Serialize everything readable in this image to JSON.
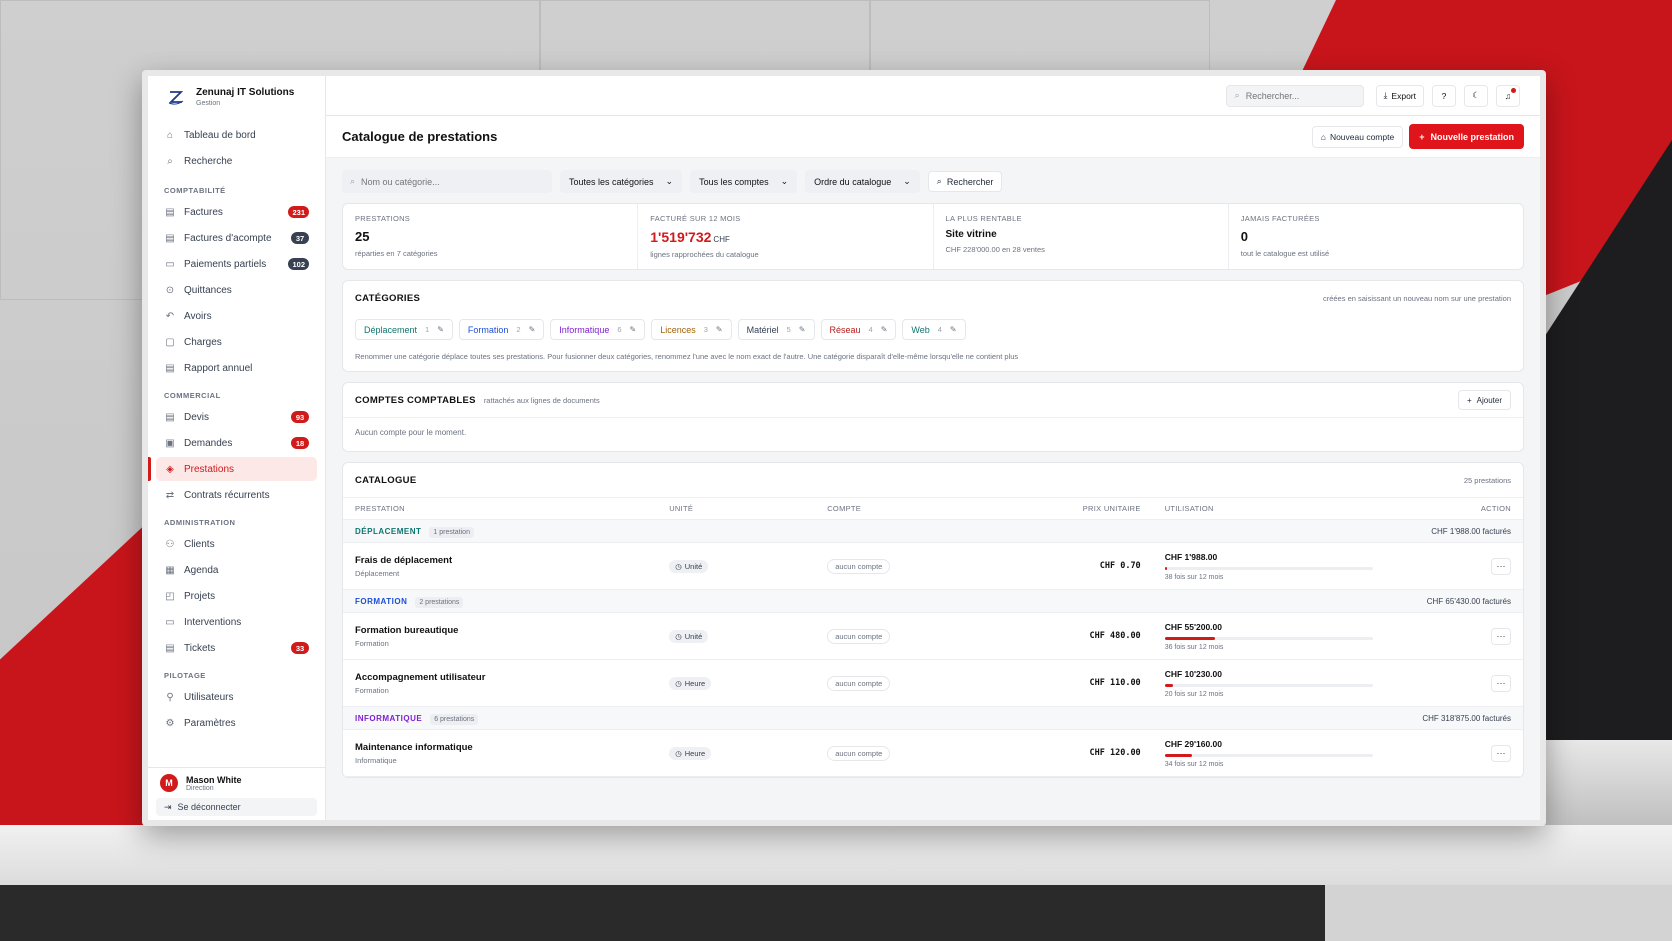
{
  "brand": {
    "name": "Zenunaj IT Solutions",
    "sub": "Gestion"
  },
  "nav": {
    "top": [
      {
        "label": "Tableau de bord",
        "icon": "home-icon"
      },
      {
        "label": "Recherche",
        "icon": "search-icon"
      }
    ],
    "sections": [
      {
        "title": "COMPTABILITÉ",
        "items": [
          {
            "label": "Factures",
            "badge": "231",
            "badge_color": "red"
          },
          {
            "label": "Factures d'acompte",
            "badge": "37",
            "badge_color": "gray"
          },
          {
            "label": "Paiements partiels",
            "badge": "102",
            "badge_color": "gray"
          },
          {
            "label": "Quittances",
            "badge": ""
          },
          {
            "label": "Avoirs",
            "badge": ""
          },
          {
            "label": "Charges",
            "badge": ""
          },
          {
            "label": "Rapport annuel",
            "badge": ""
          }
        ]
      },
      {
        "title": "COMMERCIAL",
        "items": [
          {
            "label": "Devis",
            "badge": "93",
            "badge_color": "red"
          },
          {
            "label": "Demandes",
            "badge": "18",
            "badge_color": "red"
          },
          {
            "label": "Prestations",
            "badge": "",
            "active": true
          },
          {
            "label": "Contrats récurrents",
            "badge": ""
          }
        ]
      },
      {
        "title": "ADMINISTRATION",
        "items": [
          {
            "label": "Clients",
            "badge": ""
          },
          {
            "label": "Agenda",
            "badge": ""
          },
          {
            "label": "Projets",
            "badge": ""
          },
          {
            "label": "Interventions",
            "badge": ""
          },
          {
            "label": "Tickets",
            "badge": "33",
            "badge_color": "red"
          }
        ]
      },
      {
        "title": "PILOTAGE",
        "items": [
          {
            "label": "Utilisateurs",
            "badge": ""
          },
          {
            "label": "Paramètres",
            "badge": ""
          }
        ]
      }
    ]
  },
  "user": {
    "initial": "M",
    "name": "Mason White",
    "role": "Direction",
    "logout": "Se déconnecter"
  },
  "topbar": {
    "search_placeholder": "Rechercher...",
    "export": "Export"
  },
  "page": {
    "title": "Catalogue de prestations",
    "new_account": "Nouveau compte",
    "new_service": "Nouvelle prestation"
  },
  "filters": {
    "search_placeholder": "Nom ou catégorie...",
    "categories": "Toutes les catégories",
    "accounts": "Tous les comptes",
    "order": "Ordre du catalogue",
    "search_btn": "Rechercher"
  },
  "stats": [
    {
      "label": "PRESTATIONS",
      "value": "25",
      "unit": "",
      "sub": "réparties en 7 catégories"
    },
    {
      "label": "FACTURÉ SUR 12 MOIS",
      "value": "1'519'732",
      "unit": "CHF",
      "sub": "lignes rapprochées du catalogue"
    },
    {
      "label": "LA PLUS RENTABLE",
      "value": "Site vitrine",
      "unit": "",
      "sub": "CHF 228'000.00 en 28 ventes"
    },
    {
      "label": "JAMAIS FACTURÉES",
      "value": "0",
      "unit": "",
      "sub": "tout le catalogue est utilisé"
    }
  ],
  "categories": {
    "title": "CATÉGORIES",
    "hint": "créées en saisissant un nouveau nom sur une prestation",
    "items": [
      {
        "name": "Déplacement",
        "count": "1",
        "color": "#0f766e"
      },
      {
        "name": "Formation",
        "count": "2",
        "color": "#1d4ed8"
      },
      {
        "name": "Informatique",
        "count": "6",
        "color": "#7e22ce"
      },
      {
        "name": "Licences",
        "count": "3",
        "color": "#a16207"
      },
      {
        "name": "Matériel",
        "count": "5",
        "color": "#334155"
      },
      {
        "name": "Réseau",
        "count": "4",
        "color": "#b91c1c"
      },
      {
        "name": "Web",
        "count": "4",
        "color": "#0f766e"
      }
    ],
    "note": "Renommer une catégorie déplace toutes ses prestations. Pour fusionner deux catégories, renommez l'une avec le nom exact de l'autre. Une catégorie disparaît d'elle-même lorsqu'elle ne contient plus"
  },
  "accounts": {
    "title": "COMPTES COMPTABLES",
    "sub": "rattachés aux lignes de documents",
    "add": "Ajouter",
    "empty": "Aucun compte pour le moment."
  },
  "catalogue": {
    "title": "CATALOGUE",
    "count": "25 prestations",
    "headers": [
      "PRESTATION",
      "UNITÉ",
      "COMPTE",
      "PRIX UNITAIRE",
      "UTILISATION",
      "ACTION"
    ],
    "groups": [
      {
        "name": "DÉPLACEMENT",
        "color": "#0f766e",
        "count": "1 prestation",
        "total": "CHF 1'988.00 facturés",
        "items": [
          {
            "name": "Frais de déplacement",
            "cat": "Déplacement",
            "unit": "Unité",
            "account": "aucun compte",
            "price": "CHF 0.70",
            "usage": "CHF 1'988.00",
            "usage_pct": 1,
            "usage_sub": "38 fois sur 12 mois"
          }
        ]
      },
      {
        "name": "FORMATION",
        "color": "#1d4ed8",
        "count": "2 prestations",
        "total": "CHF 65'430.00 facturés",
        "items": [
          {
            "name": "Formation bureautique",
            "cat": "Formation",
            "unit": "Unité",
            "account": "aucun compte",
            "price": "CHF 480.00",
            "usage": "CHF 55'200.00",
            "usage_pct": 24,
            "usage_sub": "36 fois sur 12 mois"
          },
          {
            "name": "Accompagnement utilisateur",
            "cat": "Formation",
            "unit": "Heure",
            "account": "aucun compte",
            "price": "CHF 110.00",
            "usage": "CHF 10'230.00",
            "usage_pct": 4,
            "usage_sub": "20 fois sur 12 mois"
          }
        ]
      },
      {
        "name": "INFORMATIQUE",
        "color": "#7e22ce",
        "count": "6 prestations",
        "total": "CHF 318'875.00 facturés",
        "items": [
          {
            "name": "Maintenance informatique",
            "cat": "Informatique",
            "unit": "Heure",
            "account": "aucun compte",
            "price": "CHF 120.00",
            "usage": "CHF 29'160.00",
            "usage_pct": 13,
            "usage_sub": "34 fois sur 12 mois"
          }
        ]
      }
    ]
  }
}
